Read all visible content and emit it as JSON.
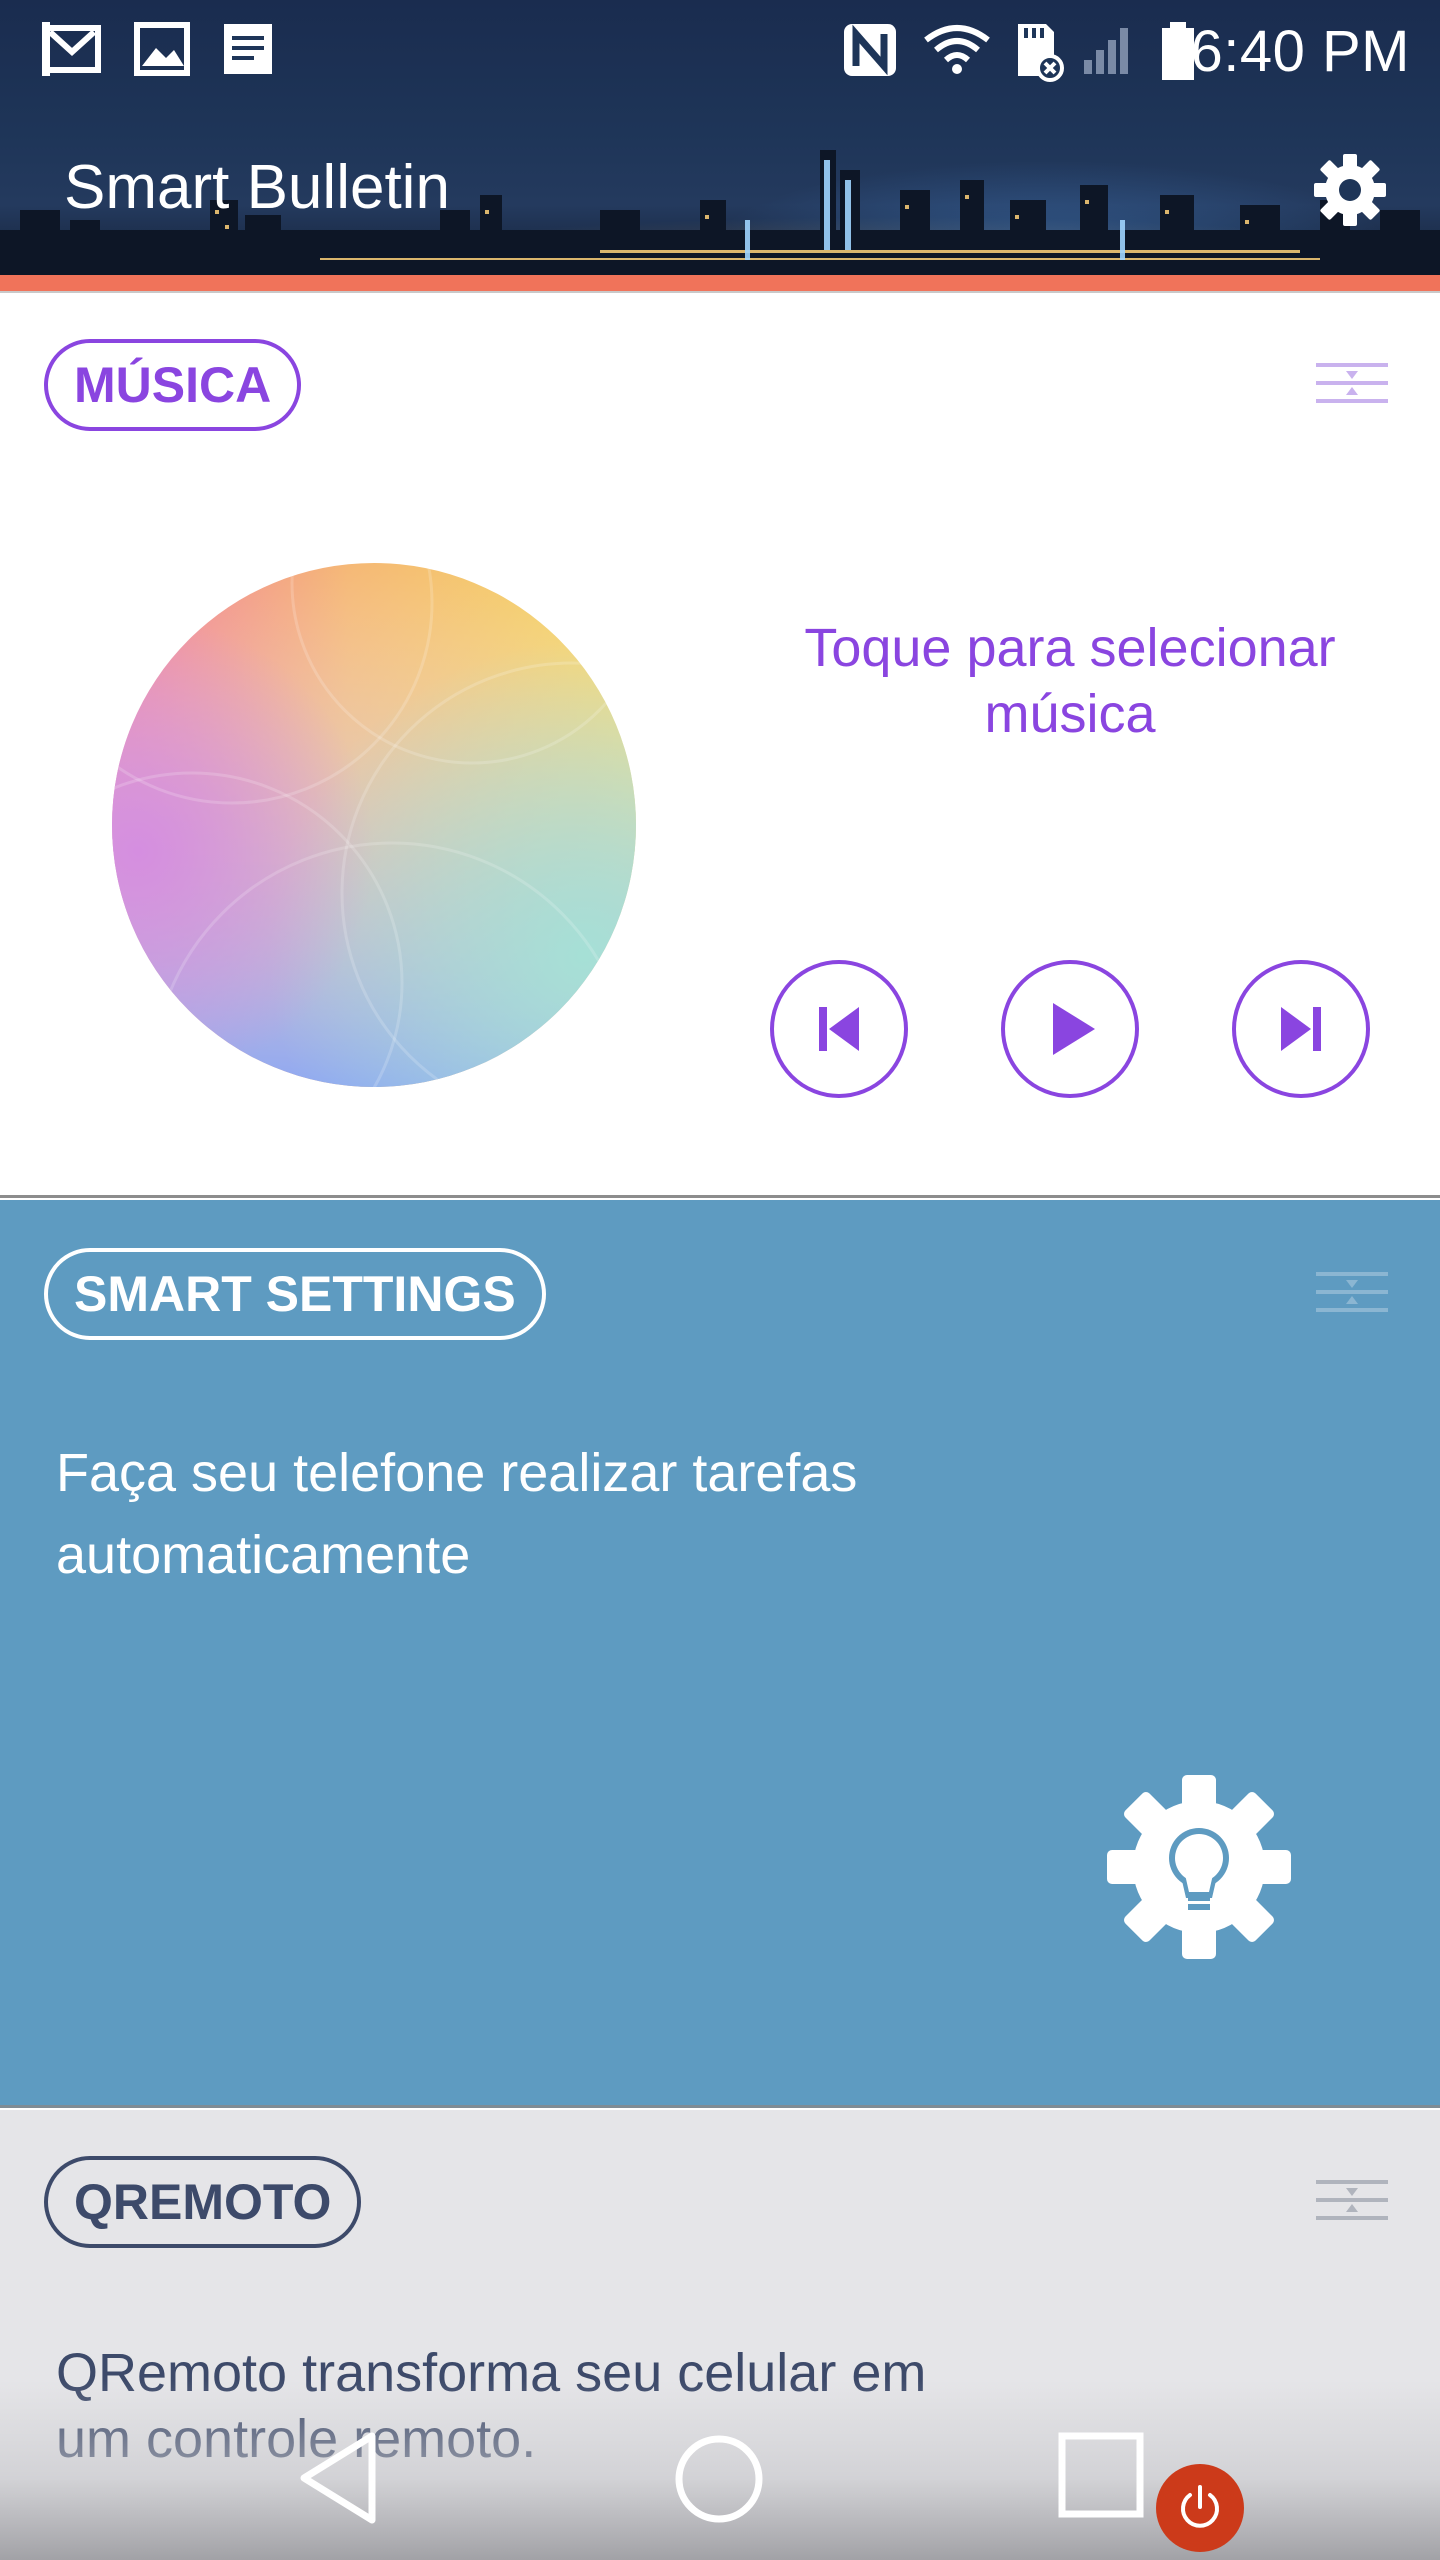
{
  "status_bar": {
    "time": "6:40 PM",
    "left_icons": [
      "gmail-icon",
      "gallery-icon",
      "notes-icon"
    ],
    "right_icons": [
      "nfc-icon",
      "wifi-icon",
      "sd-card-error-icon",
      "signal-icon",
      "battery-icon"
    ]
  },
  "header": {
    "title": "Smart Bulletin",
    "settings_icon": "gear-icon"
  },
  "colors": {
    "accent_strip": "#f0735a",
    "music": "#8a45e0",
    "smart_settings_bg": "#5e9bc1",
    "qremote_bg": "#e5e5e8",
    "qremote_text": "#3d4a6a"
  },
  "music_card": {
    "label": "MÚSICA",
    "prompt": "Toque para selecionar música",
    "controls": [
      "previous-icon",
      "play-icon",
      "next-icon"
    ]
  },
  "smart_settings_card": {
    "label": "SMART SETTINGS",
    "description": "Faça seu telefone realizar tarefas automaticamente",
    "icon": "gear-bulb-icon"
  },
  "qremote_card": {
    "label": "QREMOTO",
    "description": "QRemoto transforma seu celular em um controle remoto."
  },
  "nav_bar": {
    "buttons": [
      "back-icon",
      "home-icon",
      "recents-icon"
    ],
    "floating_button": "power-icon"
  }
}
